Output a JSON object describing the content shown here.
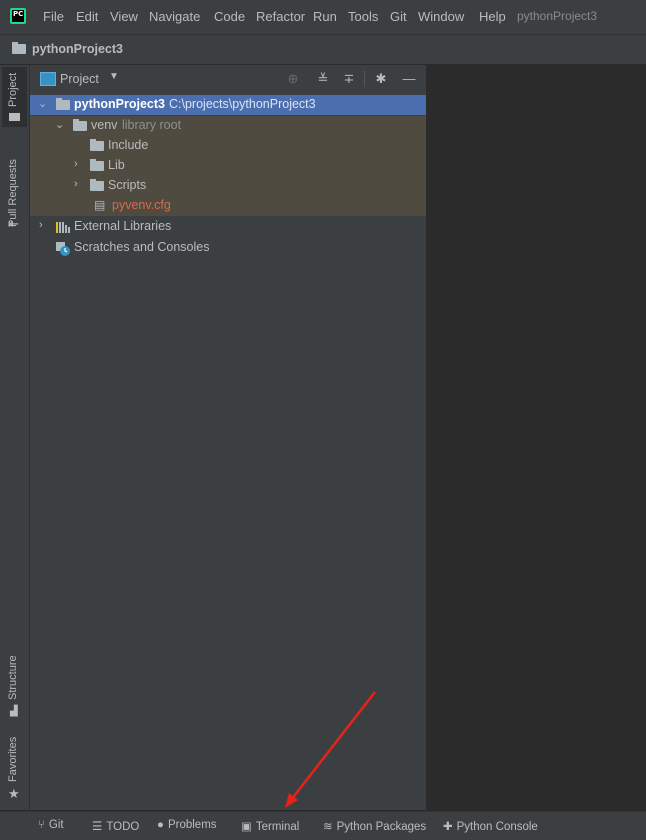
{
  "menubar": {
    "items": [
      "File",
      "Edit",
      "View",
      "Navigate",
      "Code",
      "Refactor",
      "Run",
      "Tools",
      "Git",
      "Window",
      "Help"
    ],
    "project_title": "pythonProject3"
  },
  "navbar": {
    "project_name": "pythonProject3"
  },
  "left_tabs": [
    "Project",
    "Pull Requests",
    "Structure",
    "Favorites"
  ],
  "project_panel": {
    "title": "Project",
    "tree": [
      {
        "name": "pythonProject3",
        "path": "C:\\projects\\pythonProject3"
      },
      {
        "name": "venv",
        "note": "library root"
      },
      {
        "name": "Include"
      },
      {
        "name": "Lib"
      },
      {
        "name": "Scripts"
      },
      {
        "name": "pyvenv.cfg"
      },
      {
        "name": "External Libraries"
      },
      {
        "name": "Scratches and Consoles"
      }
    ]
  },
  "statusbar": {
    "items": [
      "Git",
      "TODO",
      "Problems",
      "Terminal",
      "Python Packages",
      "Python Console"
    ]
  },
  "colors": {
    "selection": "#4b6eaf",
    "excluded_bg": "#4f4b41",
    "cfg_file": "#d66b4b",
    "annotation_arrow": "#e8221b"
  }
}
